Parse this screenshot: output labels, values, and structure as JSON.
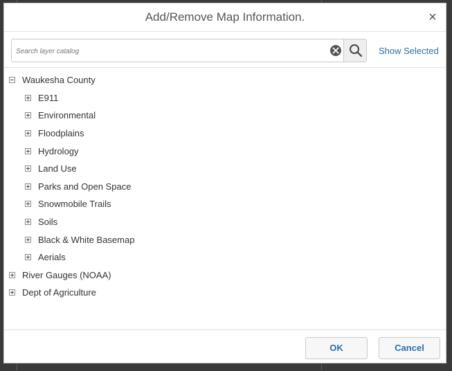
{
  "dialog": {
    "title": "Add/Remove Map Information.",
    "close_glyph": "×"
  },
  "search": {
    "placeholder": "Search layer catalog",
    "value": "",
    "clear_icon": "clear-circle-icon",
    "search_icon": "magnifier-icon",
    "show_selected_label": "Show Selected"
  },
  "tree": {
    "root": {
      "label": "Waukesha County",
      "expanded": true
    },
    "children": [
      {
        "label": "E911"
      },
      {
        "label": "Environmental"
      },
      {
        "label": "Floodplains"
      },
      {
        "label": "Hydrology"
      },
      {
        "label": "Land Use"
      },
      {
        "label": "Parks and Open Space"
      },
      {
        "label": "Snowmobile Trails"
      },
      {
        "label": "Soils"
      },
      {
        "label": "Black & White Basemap"
      },
      {
        "label": "Aerials"
      }
    ],
    "siblings": [
      {
        "label": "River Gauges (NOAA)"
      },
      {
        "label": "Dept of Agriculture"
      }
    ]
  },
  "footer": {
    "ok_label": "OK",
    "cancel_label": "Cancel"
  },
  "colors": {
    "accent": "#2a6fa8",
    "backdrop": "#3a3a3a"
  }
}
